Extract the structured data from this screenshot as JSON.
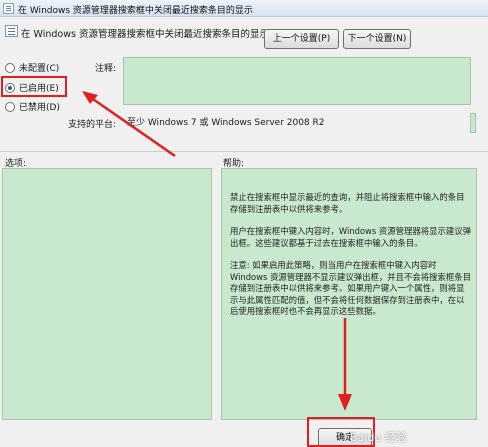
{
  "window": {
    "title": "在 Windows 资源管理器搜索框中关闭最近搜索条目的显示"
  },
  "header": {
    "policy_name": "在 Windows 资源管理器搜索框中关闭最近搜索条目的显示",
    "prev_button": "上一个设置(P)",
    "next_button": "下一个设置(N)"
  },
  "options": {
    "not_configured": "未配置(C)",
    "enabled": "已启用(E)",
    "disabled": "已禁用(D)",
    "selected": "enabled"
  },
  "labels": {
    "comment": "注释:",
    "supported_on": "支持的平台:",
    "options": "选项:",
    "help": "帮助:"
  },
  "supported_on_value": "至少 Windows 7 或 Windows Server 2008 R2",
  "help_text": {
    "p1": "禁止在搜索框中显示最近的查询，并阻止将搜索框中输入的条目存储到注册表中以供将来参考。",
    "p2": "用户在搜索框中键入内容时，Windows 资源管理器将显示建议弹出框。这些建议都基于过去在搜索框中输入的条目。",
    "p3": "注意: 如果启用此策略，则当用户在搜索框中键入内容时 Windows 资源管理器不显示建议弹出框，并且不会将搜索框条目存储到注册表中以供将来参考。如果用户键入一个属性，则将显示与此属性匹配的值，但不会将任何数据保存到注册表中，在以后使用搜索框时也不会再显示这些数据。"
  },
  "footer": {
    "ok_button": "确定"
  },
  "watermark": "Baidu 经验",
  "colors": {
    "green_panel": "#c9e9ce",
    "annotation_red": "#e02020"
  }
}
